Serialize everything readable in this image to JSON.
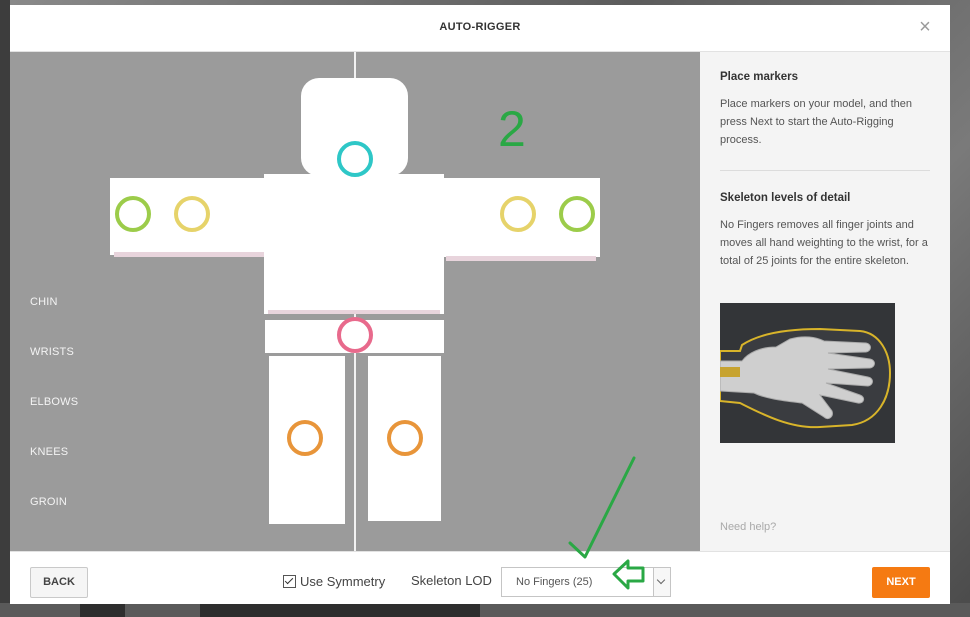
{
  "modal": {
    "title": "AUTO-RIGGER",
    "close_glyph": "×"
  },
  "viewport": {
    "annotation_number": "2",
    "marker_labels": [
      "CHIN",
      "WRISTS",
      "ELBOWS",
      "KNEES",
      "GROIN"
    ]
  },
  "side_panel": {
    "section1_title": "Place markers",
    "section1_text": "Place markers on your model, and then press Next to start the Auto-Rigging process.",
    "section2_title": "Skeleton levels of detail",
    "section2_text": "No Fingers removes all finger joints and moves all hand weighting to the wrist, for a total of 25 joints for the entire skeleton.",
    "help_link": "Need help?"
  },
  "footer": {
    "back_label": "BACK",
    "symmetry_label": "Use Symmetry",
    "symmetry_checked": true,
    "lod_label": "Skeleton LOD",
    "lod_value": "No Fingers (25)",
    "next_label": "NEXT"
  },
  "colors": {
    "chin_marker": "#2ec7c7",
    "wrist_marker": "#9ccc4a",
    "elbow_marker": "#e6d36a",
    "groin_marker": "#e86a8c",
    "knee_marker": "#e8953a",
    "annotation": "#2aa845",
    "next_button": "#f57a12"
  }
}
